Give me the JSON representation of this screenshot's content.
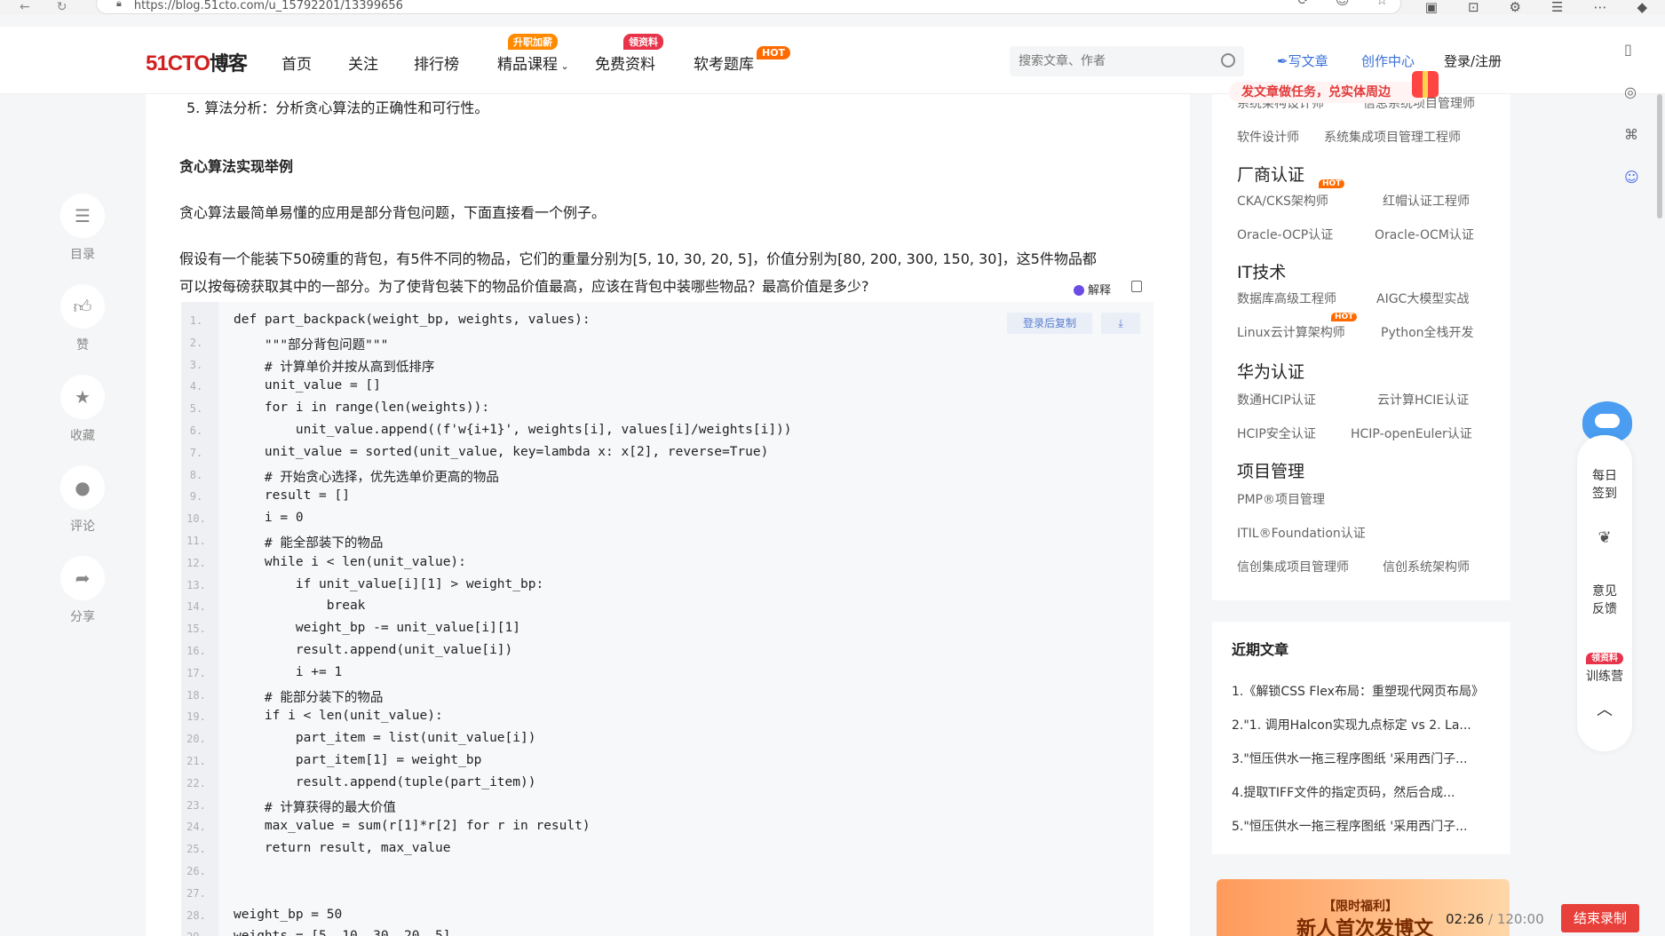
{
  "browser": {
    "url": "https://blog.51cto.com/u_15792201/13399656"
  },
  "header": {
    "logo_brand": "51CTO",
    "logo_suffix": "博客",
    "nav": [
      {
        "label": "首页"
      },
      {
        "label": "关注"
      },
      {
        "label": "排行榜"
      },
      {
        "label": "精品课程",
        "badge": "升职加薪"
      },
      {
        "label": "免费资料",
        "badge": "领资料"
      },
      {
        "label": "软考题库",
        "badge": "HOT"
      }
    ],
    "search_placeholder": "搜索文章、作者",
    "write_label": "写文章",
    "creator_label": "创作中心",
    "login_label": "登录/注册",
    "promo_text": "发文章做任务，兑实体周边"
  },
  "left_rail": [
    {
      "label": "目录",
      "icon": "menu-icon"
    },
    {
      "label": "赞",
      "icon": "thumb-up-icon"
    },
    {
      "label": "收藏",
      "icon": "star-icon"
    },
    {
      "label": "评论",
      "icon": "comment-icon"
    },
    {
      "label": "分享",
      "icon": "share-icon"
    }
  ],
  "article": {
    "item5": "5. 算法分析：分析贪心算法的正确性和可行性。",
    "section_heading": "贪心算法实现举例",
    "intro": "贪心算法最简单易懂的应用是部分背包问题，下面直接看一个例子。",
    "problem_line1": "假设有一个能装下50磅重的背包，有5件不同的物品，它们的重量分别为[5, 10, 30, 20, 5]，价值分别为[80, 200, 300, 150, 30]，这5件物品都",
    "problem_line2": "可以按每磅获取其中的一部分。为了使背包装下的物品价值最高，应该在背包中装哪些物品？最高价值是多少?",
    "explain_label": "解释",
    "copy_label": "登录后复制",
    "code_lines": [
      "def part_backpack(weight_bp, weights, values):",
      "    \"\"\"部分背包问题\"\"\"",
      "    # 计算单价并按从高到低排序",
      "    unit_value = []",
      "    for i in range(len(weights)):",
      "        unit_value.append((f'w{i+1}', weights[i], values[i]/weights[i]))",
      "    unit_value = sorted(unit_value, key=lambda x: x[2], reverse=True)",
      "    # 开始贪心选择，优先选单价更高的物品",
      "    result = []",
      "    i = 0",
      "    # 能全部装下的物品",
      "    while i < len(unit_value):",
      "        if unit_value[i][1] > weight_bp:",
      "            break",
      "        weight_bp -= unit_value[i][1]",
      "        result.append(unit_value[i])",
      "        i += 1",
      "    # 能部分装下的物品",
      "    if i < len(unit_value):",
      "        part_item = list(unit_value[i])",
      "        part_item[1] = weight_bp",
      "        result.append(tuple(part_item))",
      "    # 计算获得的最大价值",
      "    max_value = sum(r[1]*r[2] for r in result)",
      "    return result, max_value",
      "",
      "",
      "weight_bp = 50",
      "weights = [5, 10, 30, 20, 5]"
    ]
  },
  "sidebar": {
    "top_partial": [
      "系统架构设计师",
      "信息系统项目管理师"
    ],
    "row_1": [
      "软件设计师",
      "系统集成项目管理工程师"
    ],
    "groups": [
      {
        "title": "厂商认证",
        "links": [
          "CKA/CKS架构师",
          "红帽认证工程师",
          "Oracle-OCP认证",
          "Oracle-OCM认证"
        ]
      },
      {
        "title": "IT技术",
        "links": [
          "数据库高级工程师",
          "AIGC大模型实战",
          "Linux云计算架构师",
          "Python全栈开发"
        ]
      },
      {
        "title": "华为认证",
        "links": [
          "数通HCIP认证",
          "云计算HCIE认证",
          "HCIP安全认证",
          "HCIP-openEuler认证"
        ]
      },
      {
        "title": "项目管理",
        "links": [
          "PMP®项目管理",
          "ITIL®Foundation认证",
          "信创集成项目管理师",
          "信创系统架构师"
        ]
      }
    ],
    "hot_badge": "HOT",
    "recent_title": "近期文章",
    "recent": [
      "1.《解锁CSS Flex布局：重塑现代网页布局》",
      "2.\"1. 调用Halcon实现九点标定 vs 2. La...",
      "3.\"恒压供水一拖三程序图纸 '采用西门子...",
      "4.提取TIFF文件的指定页码，然后合成...",
      "5.\"恒压供水一拖三程序图纸 '采用西门子..."
    ],
    "promo_tag": "【限时福利】",
    "promo_text": "新人首次发博文"
  },
  "float_rail": {
    "checkin": [
      "每日",
      "签到"
    ],
    "feedback": [
      "意见",
      "反馈"
    ],
    "camp_badge": "领资料",
    "camp_label": "训练营"
  },
  "recorder": {
    "elapsed": "02:26",
    "total": "/ 120:00",
    "stop_label": "结束录制"
  }
}
